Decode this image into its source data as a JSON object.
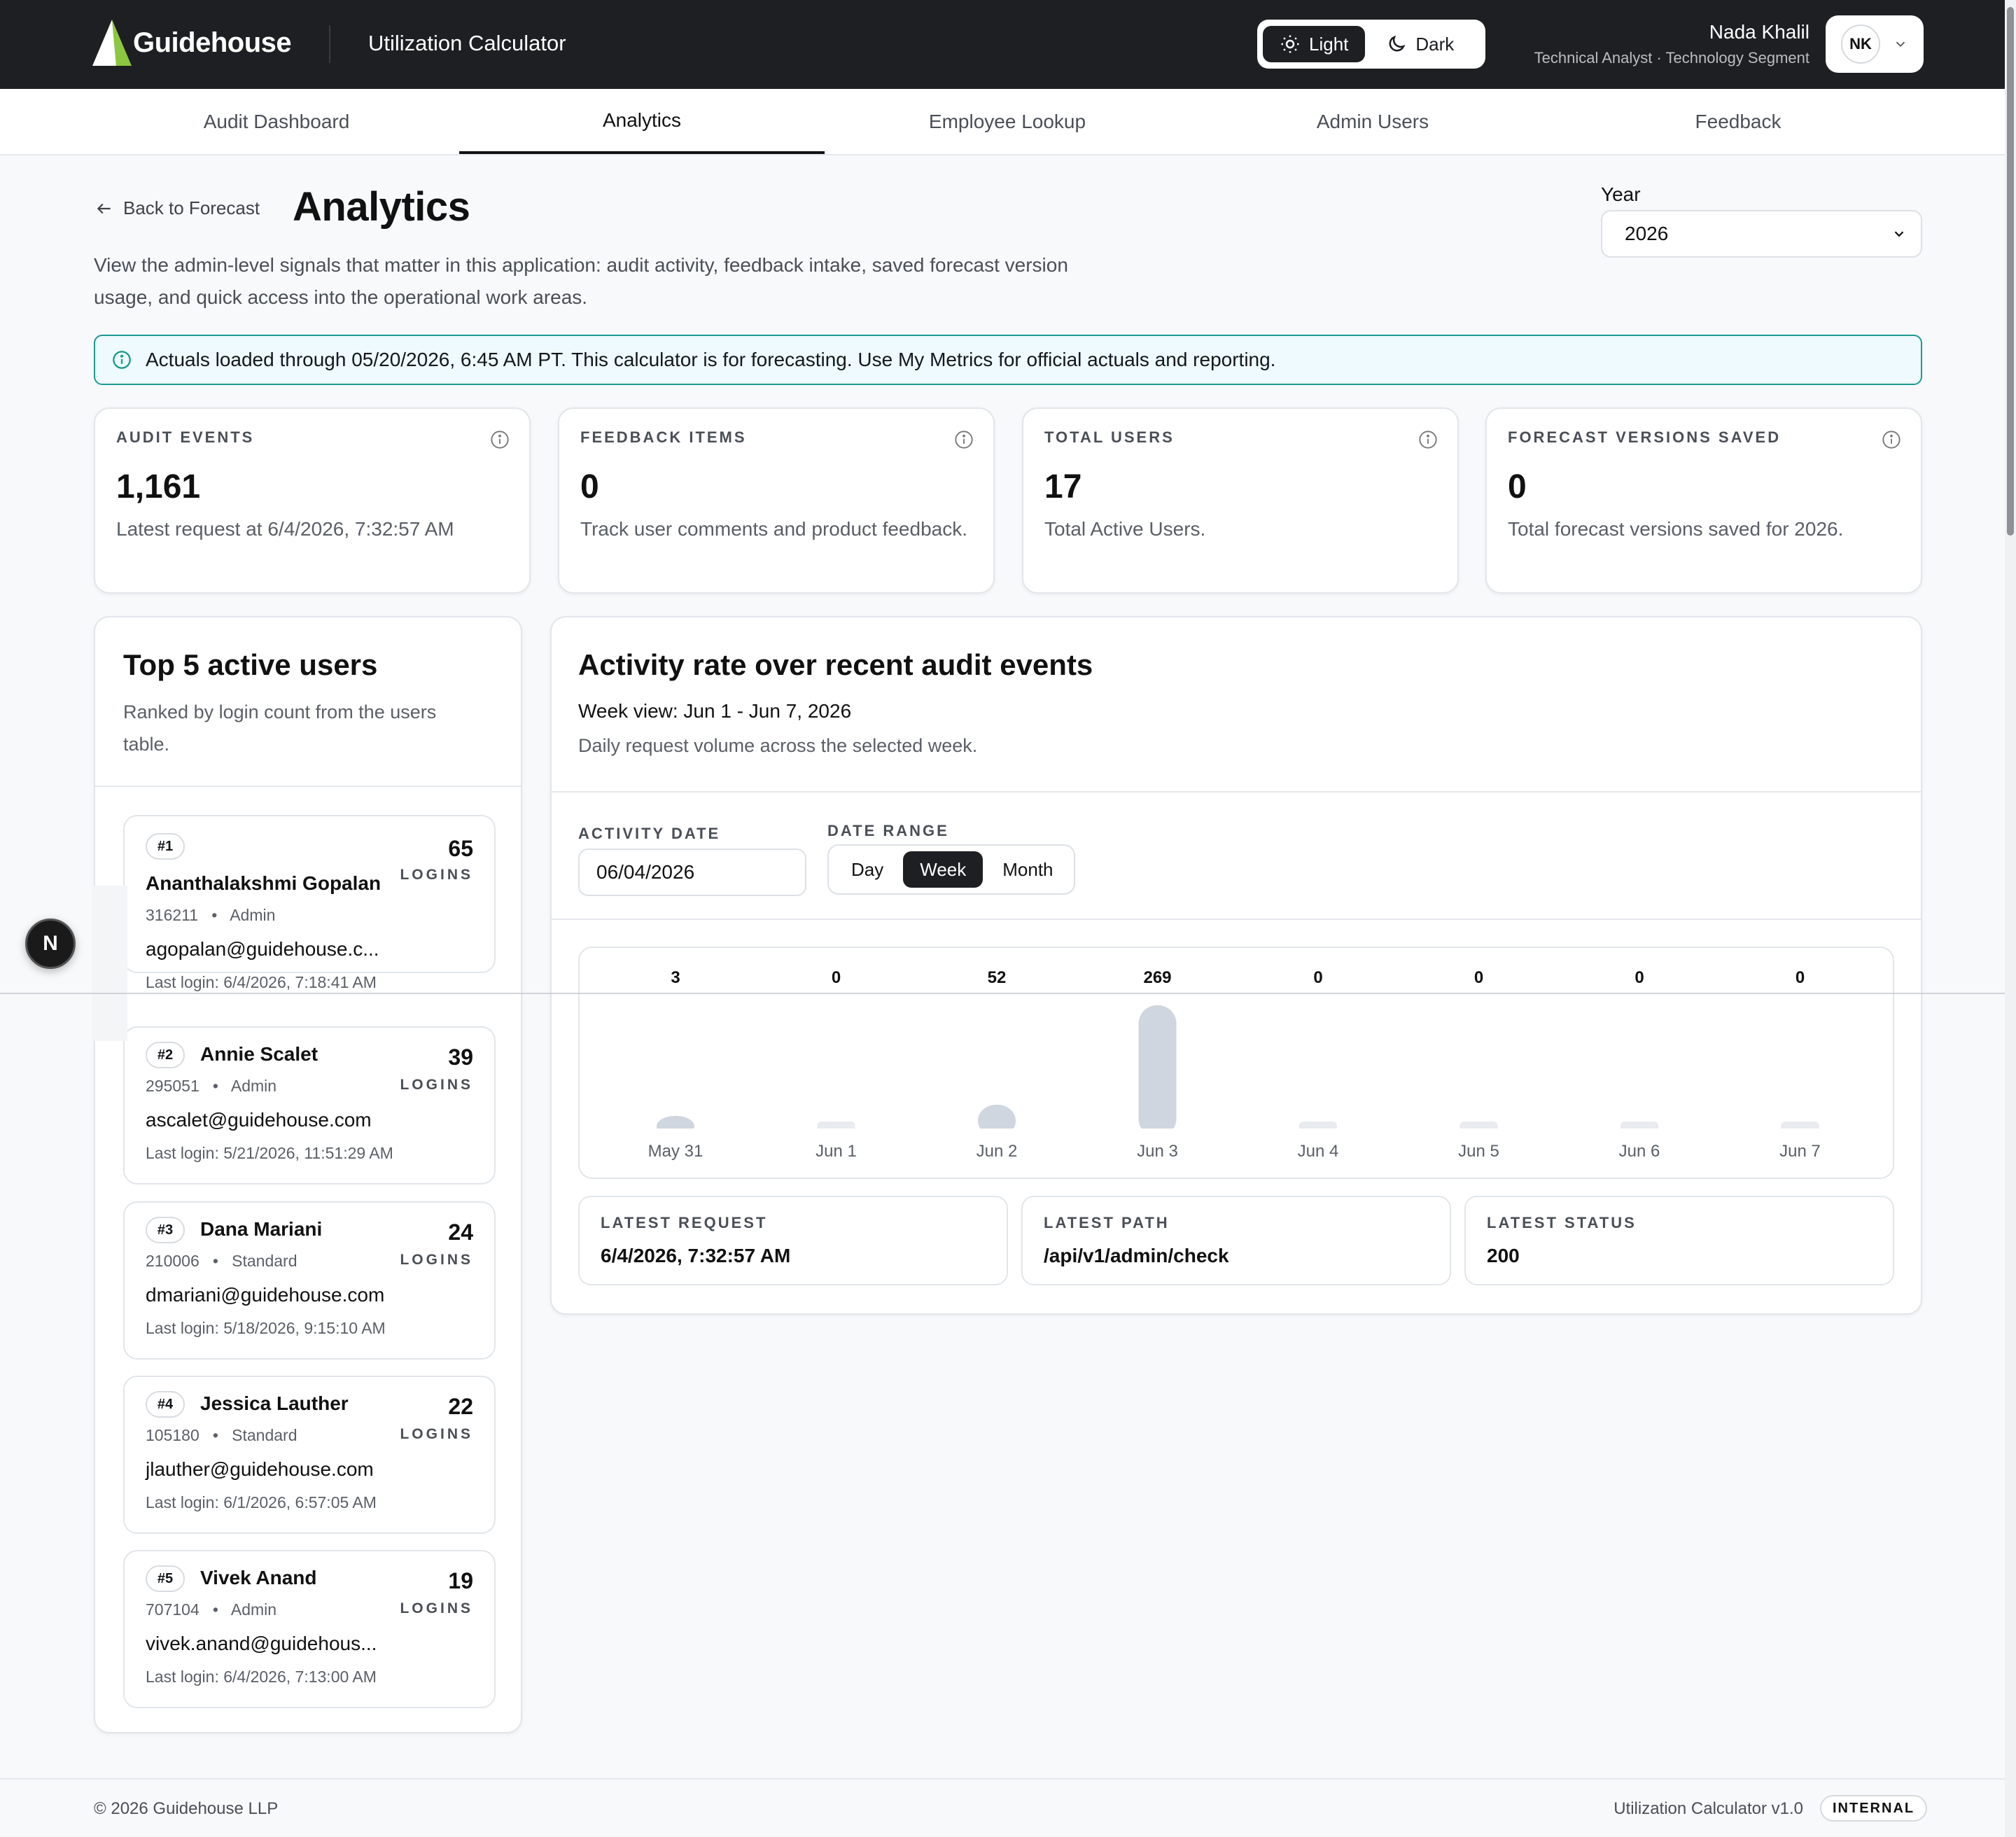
{
  "header": {
    "brand": "Guidehouse",
    "app_title": "Utilization Calculator",
    "theme": {
      "light_label": "Light",
      "dark_label": "Dark",
      "selected": "Light"
    },
    "user": {
      "name": "Nada Khalil",
      "role": "Technical Analyst · Technology Segment",
      "initials": "NK"
    }
  },
  "tabs": [
    {
      "label": "Audit Dashboard",
      "active": false
    },
    {
      "label": "Analytics",
      "active": true
    },
    {
      "label": "Employee Lookup",
      "active": false
    },
    {
      "label": "Admin Users",
      "active": false
    },
    {
      "label": "Feedback",
      "active": false
    }
  ],
  "page": {
    "back_label": "Back to Forecast",
    "title": "Analytics",
    "description": "View the admin-level signals that matter in this application: audit activity, feedback intake, saved forecast version usage, and quick access into the operational work areas.",
    "year_label": "Year",
    "year_value": "2026"
  },
  "banner": {
    "text": "Actuals loaded through 05/20/2026, 6:45 AM PT. This calculator is for forecasting. Use My Metrics for official actuals and reporting."
  },
  "metrics": [
    {
      "label": "AUDIT EVENTS",
      "value": "1,161",
      "sub": "Latest request at 6/4/2026, 7:32:57 AM"
    },
    {
      "label": "FEEDBACK ITEMS",
      "value": "0",
      "sub": "Track user comments and product feedback."
    },
    {
      "label": "TOTAL USERS",
      "value": "17",
      "sub": "Total Active Users."
    },
    {
      "label": "FORECAST VERSIONS SAVED",
      "value": "0",
      "sub": "Total forecast versions saved for 2026."
    }
  ],
  "top_users": {
    "title": "Top 5 active users",
    "subtitle": "Ranked by login count from the users table.",
    "logins_label": "LOGINS",
    "users": [
      {
        "rank": "#1",
        "name": "Ananthalakshmi Gopalan",
        "id": "316211",
        "role": "Admin",
        "email": "agopalan@guidehouse.c...",
        "last_login": "Last login: 6/4/2026, 7:18:41 AM",
        "logins": "65"
      },
      {
        "rank": "#2",
        "name": "Annie Scalet",
        "id": "295051",
        "role": "Admin",
        "email": "ascalet@guidehouse.com",
        "last_login": "Last login: 5/21/2026, 11:51:29 AM",
        "logins": "39"
      },
      {
        "rank": "#3",
        "name": "Dana Mariani",
        "id": "210006",
        "role": "Standard",
        "email": "dmariani@guidehouse.com",
        "last_login": "Last login: 5/18/2026, 9:15:10 AM",
        "logins": "24"
      },
      {
        "rank": "#4",
        "name": "Jessica Lauther",
        "id": "105180",
        "role": "Standard",
        "email": "jlauther@guidehouse.com",
        "last_login": "Last login: 6/1/2026, 6:57:05 AM",
        "logins": "22"
      },
      {
        "rank": "#5",
        "name": "Vivek Anand",
        "id": "707104",
        "role": "Admin",
        "email": "vivek.anand@guidehous...",
        "last_login": "Last login: 6/4/2026, 7:13:00 AM",
        "logins": "19"
      }
    ]
  },
  "activity": {
    "title": "Activity rate over recent audit events",
    "week_view": "Week view: Jun 1 - Jun 7, 2026",
    "description": "Daily request volume across the selected week.",
    "activity_date_label": "ACTIVITY DATE",
    "activity_date_value": "06/04/2026",
    "date_range_label": "DATE RANGE",
    "date_range_options": [
      "Day",
      "Week",
      "Month"
    ],
    "date_range_selected": "Week",
    "latest": [
      {
        "label": "LATEST REQUEST",
        "value": "6/4/2026, 7:32:57 AM"
      },
      {
        "label": "LATEST PATH",
        "value": "/api/v1/admin/check"
      },
      {
        "label": "LATEST STATUS",
        "value": "200"
      }
    ]
  },
  "chart_data": {
    "type": "bar",
    "categories": [
      "May 31",
      "Jun 1",
      "Jun 2",
      "Jun 3",
      "Jun 4",
      "Jun 5",
      "Jun 6",
      "Jun 7"
    ],
    "values": [
      3,
      0,
      52,
      269,
      0,
      0,
      0,
      0
    ],
    "title": "",
    "xlabel": "",
    "ylabel": "",
    "grid": false,
    "bar_color": "#cfd6df"
  },
  "footer": {
    "copyright": "© 2026 Guidehouse LLP",
    "version": "Utilization Calculator v1.0",
    "badge": "INTERNAL"
  },
  "floating_badge": "N",
  "colors": {
    "header_bg": "#1e1f22",
    "accent_teal": "#1c9a8f",
    "logo_green": "#8dc63f"
  }
}
